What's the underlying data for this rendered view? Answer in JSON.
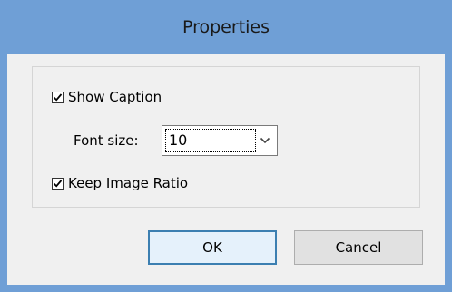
{
  "dialog": {
    "title": "Properties",
    "show_caption": {
      "label": "Show Caption",
      "checked": true
    },
    "font_size": {
      "label": "Font size:",
      "value": "10"
    },
    "keep_ratio": {
      "label": "Keep Image Ratio",
      "checked": true
    },
    "ok_label": "OK",
    "cancel_label": "Cancel"
  },
  "colors": {
    "frame": "#6f9fd6",
    "client": "#f0f0f0",
    "default_button_border": "#3c7fb1"
  }
}
